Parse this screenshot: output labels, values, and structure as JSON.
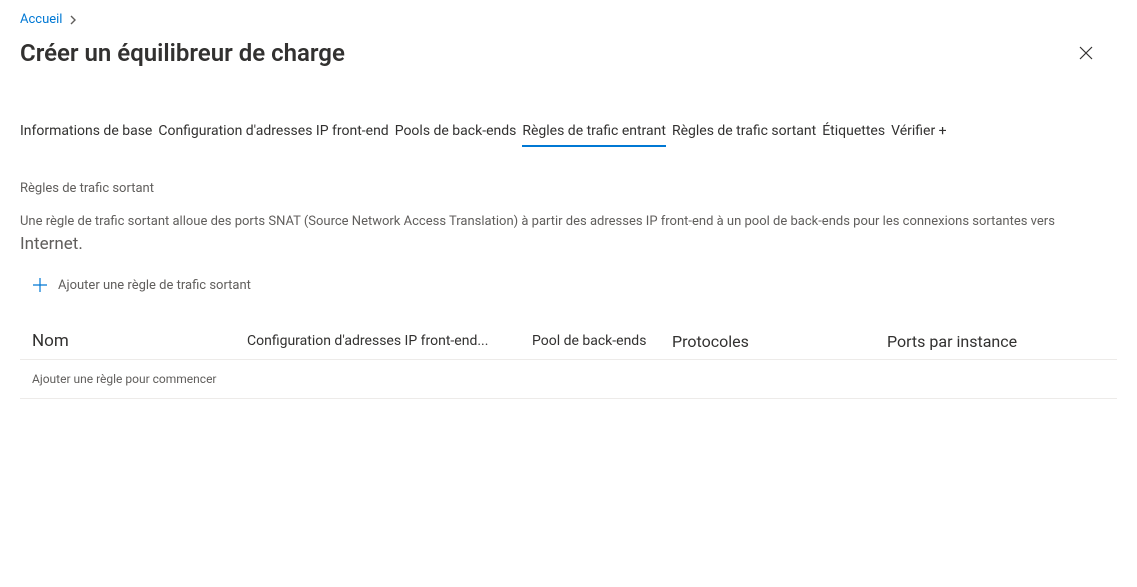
{
  "breadcrumb": {
    "home": "Accueil"
  },
  "header": {
    "title": "Créer un équilibreur de charge"
  },
  "tabs": {
    "basics": "Informations de base",
    "frontend": "Configuration d'adresses IP front-end",
    "backend": "Pools de back-ends",
    "inbound": "Règles de trafic entrant",
    "outbound": "Règles de trafic sortant",
    "tags": "Étiquettes",
    "review": "Vérifier +"
  },
  "outbound_section": {
    "heading": "Règles de trafic sortant",
    "desc_part1": "Une règle de trafic sortant alloue des ports SNAT (Source Network Access Translation) à partir des adresses IP front-end à un pool de back-ends pour les connexions sortantes vers ",
    "desc_emph": "Internet.",
    "add_label": "Ajouter une règle de trafic sortant"
  },
  "table": {
    "columns": {
      "name": "Nom",
      "frontend_ip": "Configuration d'adresses IP front-end...",
      "backend_pool": "Pool de back-ends",
      "protocols": "Protocoles",
      "ports_per_instance": "Ports par instance"
    },
    "empty": "Ajouter une règle pour commencer"
  }
}
